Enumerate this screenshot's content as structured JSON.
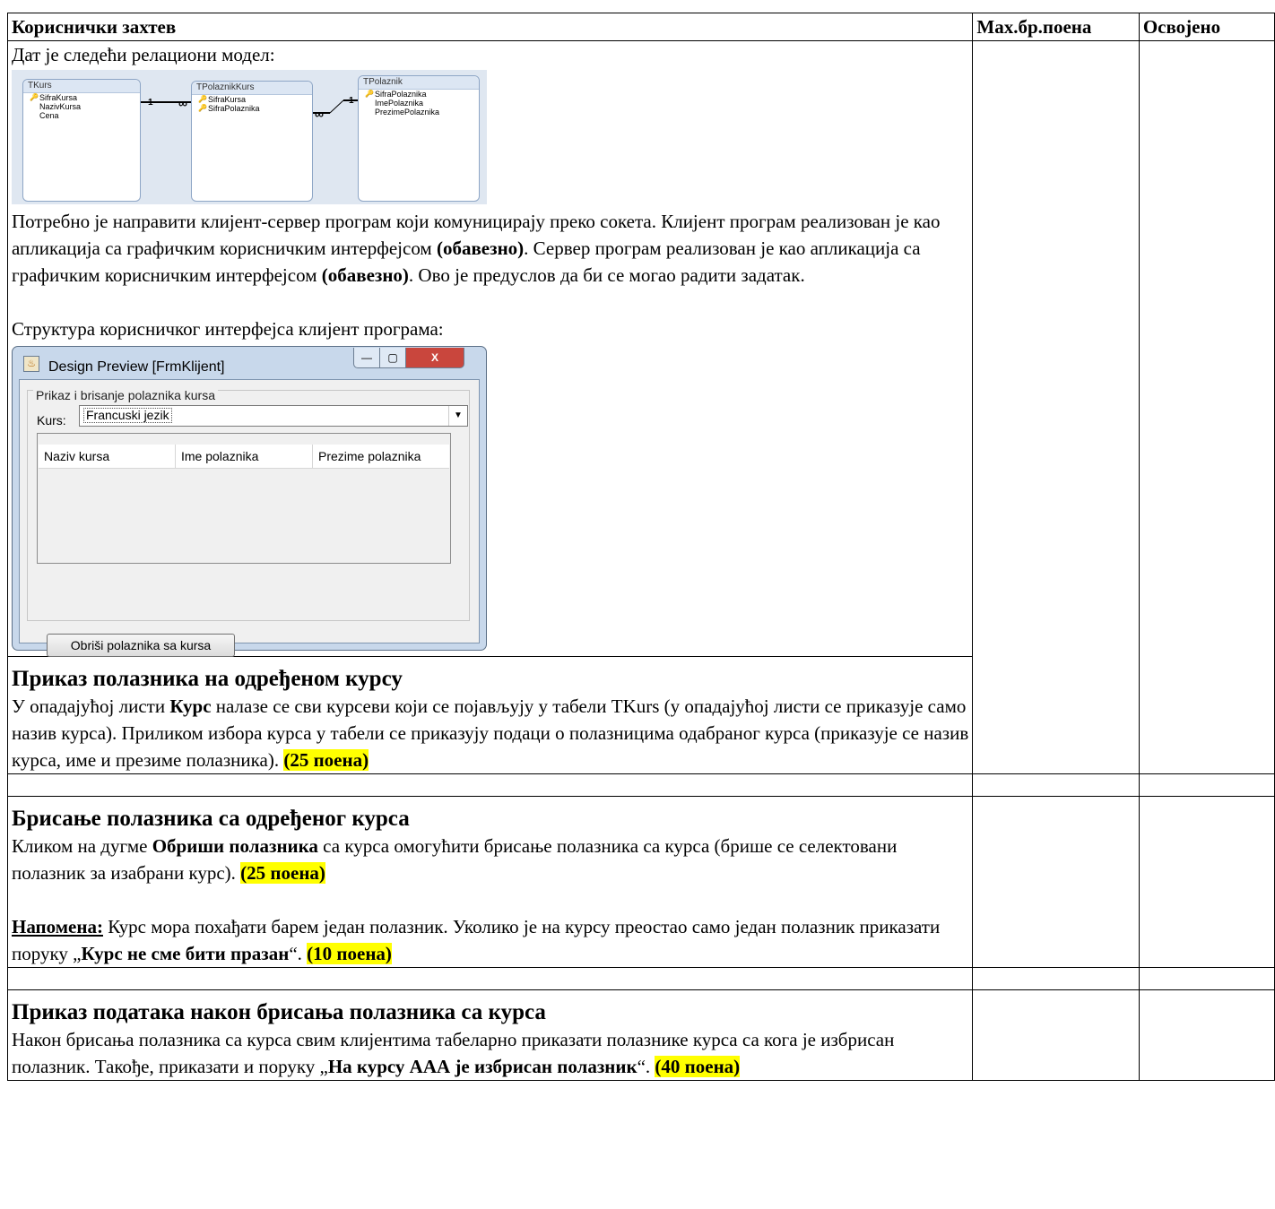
{
  "header": {
    "col1": "Кориснички захтев",
    "col2": "Max.бр.поена",
    "col3": "Освојено"
  },
  "intro": {
    "model_line": "Дат је следећи релациони модел:",
    "relational_model": {
      "tables": [
        {
          "name": "TKurs",
          "fields": [
            {
              "name": "SifraKursa",
              "key": true
            },
            {
              "name": "NazivKursa",
              "key": false
            },
            {
              "name": "Cena",
              "key": false
            }
          ]
        },
        {
          "name": "TPolaznikKurs",
          "fields": [
            {
              "name": "SifraKursa",
              "key": true
            },
            {
              "name": "SifraPolaznika",
              "key": true
            }
          ]
        },
        {
          "name": "TPolaznik",
          "fields": [
            {
              "name": "SifraPolaznika",
              "key": true
            },
            {
              "name": "ImePolaznika",
              "key": false
            },
            {
              "name": "PrezimePolaznika",
              "key": false
            }
          ]
        }
      ],
      "rel1_one": "1",
      "rel1_many": "∞",
      "rel2_many": "∞",
      "rel2_one": "1"
    },
    "para1_a": "Потребно је направити клијент-сервер програм који комуницирају преко сокета. Клијент програм реализован је као апликација са графичким корисничким интерфејсом ",
    "para1_b": "(обавезно)",
    "para1_c": ". Сервер програм реализован је као апликација са графичким корисничким интерфејсом ",
    "para1_d": "(обавезно)",
    "para1_e": ". Ово је предуслов да би се могао радити задатак.",
    "structure_line": "Структура корисничког интерфејса клијент програма:"
  },
  "window": {
    "title": "Design Preview [FrmKlijent]",
    "min_glyph": "—",
    "max_glyph": "▢",
    "close_glyph": "X",
    "app_icon_glyph": "♨",
    "legend": "Prikaz i brisanje polaznika kursa",
    "kurs_label": "Kurs:",
    "combo_value": "Francuski jezik",
    "combo_arrow": "▼",
    "columns": [
      "Naziv kursa",
      "Ime polaznika",
      "Prezime polaznika"
    ],
    "button": "Obriši polaznika sa kursa"
  },
  "section1": {
    "title": "Приказ полазника на одређеном курсу",
    "t1": "У опадајућој листи ",
    "t2": "Курс",
    "t3": " налазе се сви курсеви који се појављују у табели TKurs (у опадајућој листи се приказује само назив курса). Приликом избора курса у табели се приказују подаци о полазницима одабраног курса (приказује се назив курса, име и презиме полазника). ",
    "points": "(25 поена)"
  },
  "section2": {
    "title": "Брисање полазника са одређеног курса",
    "t1": "Кликом на дугме ",
    "t2": "Обриши полазника",
    "t3": " са курса омогућити брисање полазника са курса (брише се селектовани полазник за изабрани курс). ",
    "points": "(25 поена)",
    "note_label": "Напомена:",
    "note_t1": " Курс мора похађати барем један полазник. Уколико је на курсу преостао само један полазник приказати поруку „",
    "note_msg": "Курс не сме бити празан",
    "note_t2": "“. ",
    "note_points": "(10 поена)"
  },
  "section3": {
    "title": "Приказ података након брисања полазника са курса",
    "t1": "Након брисања полазника са курса свим клијентима табеларно приказати полазнике курса са кога је избрисан полазник. Такође, приказати и поруку „",
    "msg": "На курсу ААА је избрисан полазник",
    "t2": "“. ",
    "points": "(40 поена)"
  }
}
